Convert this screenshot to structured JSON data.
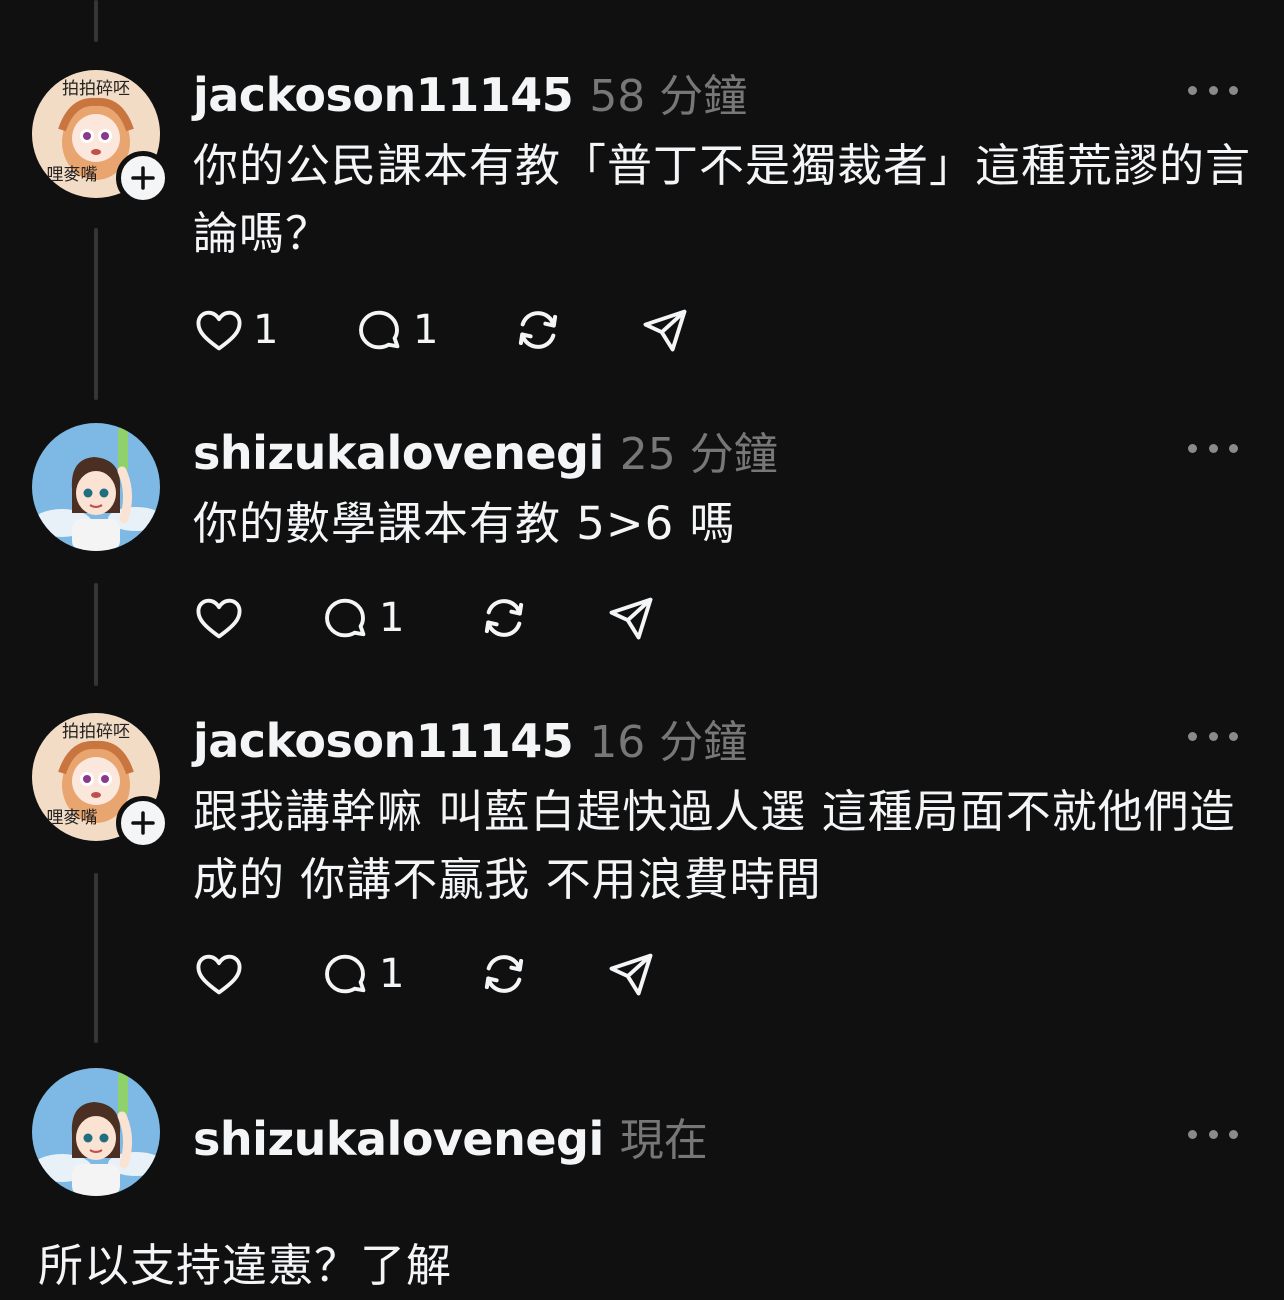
{
  "comments": [
    {
      "username": "jackoson11145",
      "time": "58 分鐘",
      "avatar_text_top": "拍拍碎呸",
      "avatar_text_bottom": "哩麥嘴",
      "text": "你的公民課本有教「普丁不是獨裁者」這種荒謬的言論嗎？",
      "likes": "1",
      "replies": "1"
    },
    {
      "username": "shizukalovenegi",
      "time": "25 分鐘",
      "text": "你的數學課本有教 5>6 嗎",
      "replies": "1"
    },
    {
      "username": "jackoson11145",
      "time": "16 分鐘",
      "avatar_text_top": "拍拍碎呸",
      "avatar_text_bottom": "哩麥嘴",
      "text": "跟我講幹嘛 叫藍白趕快過人選 這種局面不就他們造成的 你講不贏我 不用浪費時間",
      "replies": "1"
    },
    {
      "username": "shizukalovenegi",
      "time": "現在"
    }
  ],
  "reply_input": {
    "text": "所以支持違憲？了解"
  },
  "icons": [
    "heart-icon",
    "comment-icon",
    "repost-icon",
    "share-icon",
    "more-icon",
    "plus-icon"
  ],
  "colors": {
    "background": "#101010",
    "text": "#f3f5f7",
    "secondary": "#777777",
    "thread_line": "#333638"
  }
}
